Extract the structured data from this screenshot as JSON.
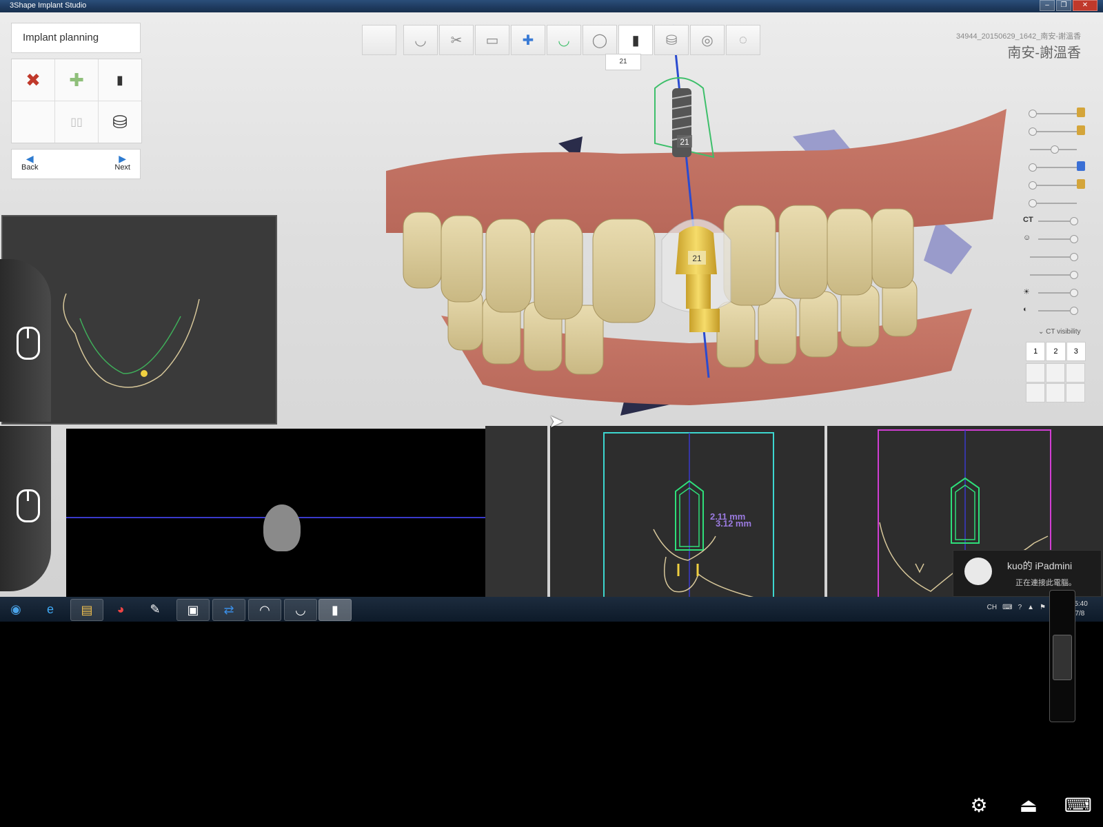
{
  "window": {
    "title": "3Shape Implant Studio"
  },
  "plan_panel": {
    "title": "Implant planning",
    "back_label": "Back",
    "next_label": "Next"
  },
  "workflow": {
    "tooth_tag": "21"
  },
  "patient": {
    "case_id": "34944_20150629_1642_南安-謝溫香",
    "name": "南安-謝溫香"
  },
  "view3d": {
    "implant_label_top": "21",
    "implant_label_crown": "21"
  },
  "sliders": {
    "ct_label": "CT",
    "ct_visibility": "CT visibility"
  },
  "view_buttons": [
    "1",
    "2",
    "3"
  ],
  "sections": {
    "measure1": "2.11 mm",
    "measure2": "3.12 mm"
  },
  "notification": {
    "device": "kuo的 iPadmini",
    "status": "正在連接此電腦。"
  },
  "tray": {
    "lang": "CH",
    "time": "下午 05:40",
    "date": "2015/7/8"
  },
  "colors": {
    "implant": "#e5c23a",
    "section1_frame": "#3cd7d0",
    "section2_frame": "#d23ed4",
    "axis": "#3a3acc"
  }
}
